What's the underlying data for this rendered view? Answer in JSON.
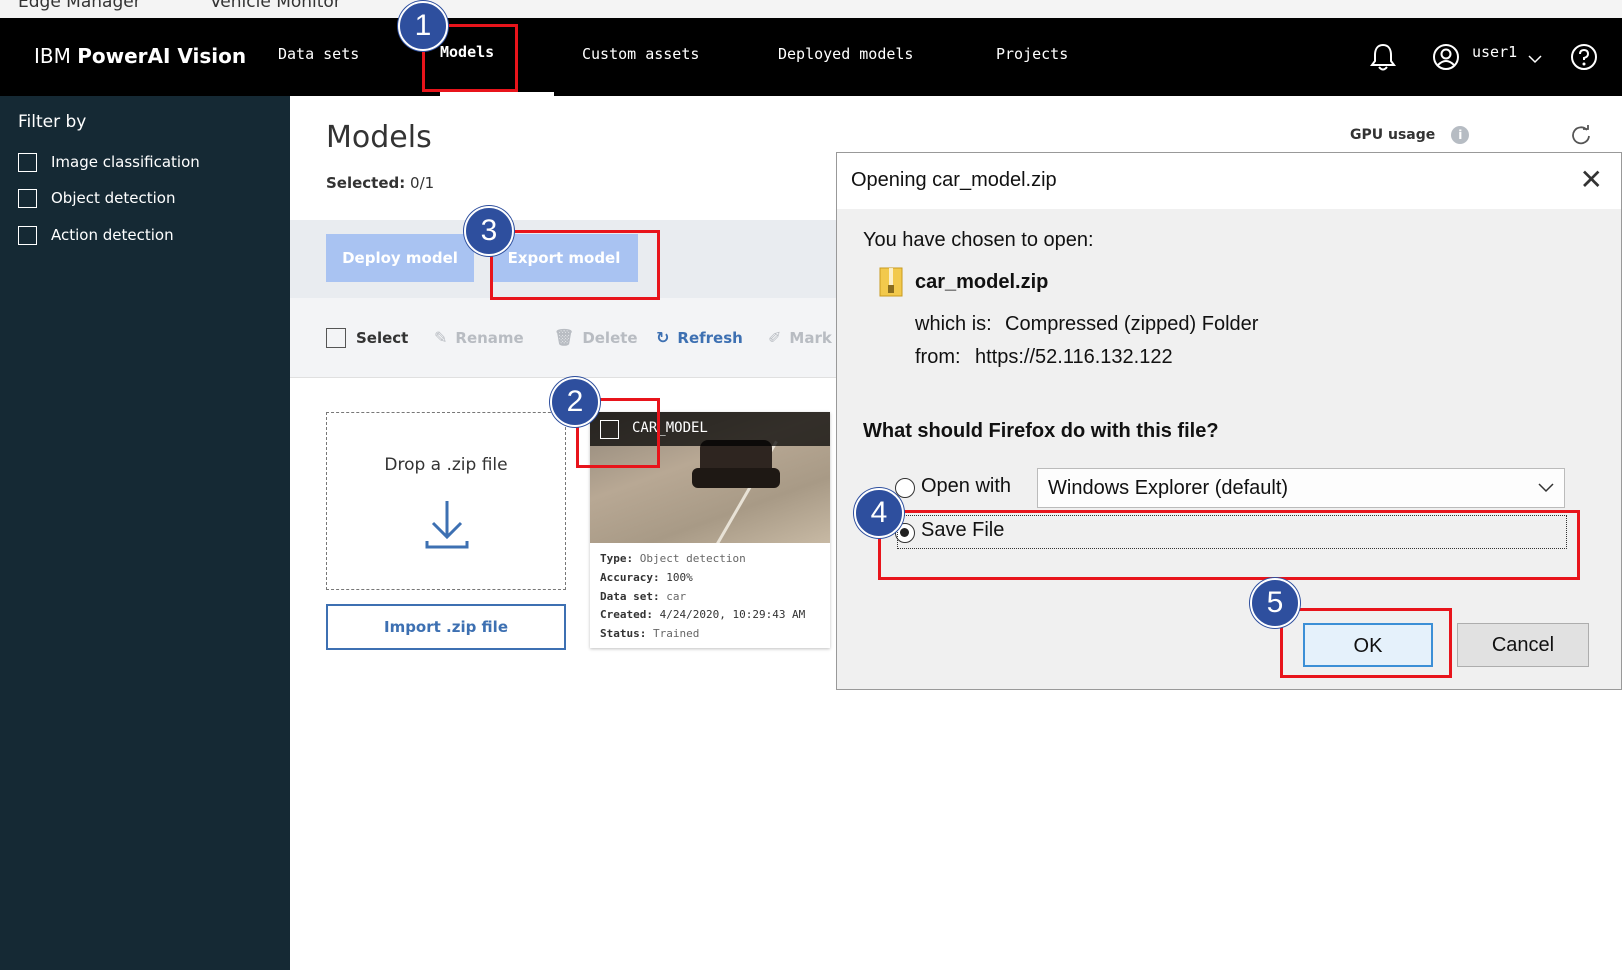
{
  "browser_strip": {
    "items": [
      "Edge Manager",
      "Vehicle Monitor"
    ]
  },
  "header": {
    "brand_prefix": "IBM",
    "brand_name": "PowerAI Vision",
    "nav": [
      {
        "label": "Data sets",
        "active": false
      },
      {
        "label": "Models",
        "active": true
      },
      {
        "label": "Custom assets",
        "active": false
      },
      {
        "label": "Deployed models",
        "active": false
      },
      {
        "label": "Projects",
        "active": false
      }
    ],
    "user": "user1",
    "icons": [
      "bell-icon",
      "user-circle-icon",
      "chevron-down-icon",
      "help-icon"
    ]
  },
  "sidebar": {
    "title": "Filter by",
    "filters": [
      {
        "label": "Image classification",
        "checked": false
      },
      {
        "label": "Object detection",
        "checked": false
      },
      {
        "label": "Action detection",
        "checked": false
      }
    ]
  },
  "main": {
    "title": "Models",
    "selected_label": "Selected:",
    "selected_value": "0/1",
    "gpu_label": "GPU usage",
    "actions": {
      "deploy": "Deploy model",
      "export": "Export model"
    },
    "toolbar": {
      "select": "Select",
      "rename": "Rename",
      "delete": "Delete",
      "refresh": "Refresh",
      "mark": "Mark"
    },
    "dropzone": {
      "text": "Drop a .zip file",
      "import_button": "Import .zip file"
    },
    "card": {
      "name": "CAR_MODEL",
      "type_label": "Type:",
      "type_value": "Object detection",
      "accuracy_label": "Accuracy:",
      "accuracy_value": "100%",
      "dataset_label": "Data set:",
      "dataset_value": "car",
      "created_label": "Created:",
      "created_value": "4/24/2020, 10:29:43 AM",
      "status_label": "Status:",
      "status_value": "Trained"
    }
  },
  "dialog": {
    "title": "Opening car_model.zip",
    "chosen_label": "You have chosen to open:",
    "filename": "car_model.zip",
    "which_is_label": "which is:",
    "which_is_value": "Compressed (zipped) Folder",
    "from_label": "from:",
    "from_value": "https://52.116.132.122",
    "question": "What should Firefox do with this file?",
    "open_with_label": "Open with",
    "open_with_value": "Windows Explorer (default)",
    "save_file_label": "Save File",
    "selected_option": "save_file",
    "ok": "OK",
    "cancel": "Cancel"
  },
  "annotations": {
    "steps": [
      "1",
      "2",
      "3",
      "4",
      "5"
    ],
    "highlight_color": "#e8141b",
    "badge_color": "#2e4f9e"
  },
  "colors": {
    "header_bg": "#000000",
    "sidebar_bg": "#152934",
    "accent_blue": "#3d70b2",
    "disabled_button": "#a9c3f2"
  }
}
